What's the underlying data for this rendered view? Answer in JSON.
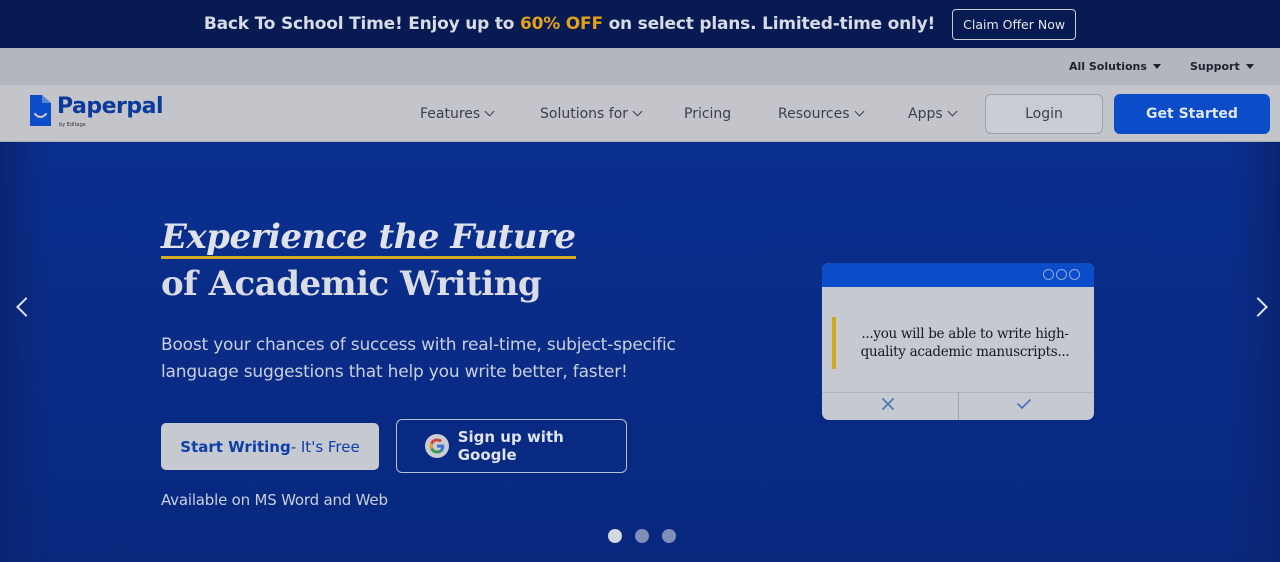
{
  "promo": {
    "text_before": "Back To School Time! Enjoy up to ",
    "highlight": "60% OFF",
    "text_after": " on select plans. Limited-time only!",
    "cta": "Claim Offer Now",
    "highlight_color": "#e3a11a"
  },
  "utility": {
    "all_solutions": "All Solutions",
    "support": "Support"
  },
  "nav": {
    "logo_text": "Paperpal",
    "logo_sub": "by Editage",
    "items": [
      "Features",
      "Solutions for",
      "Pricing",
      "Resources",
      "Apps"
    ],
    "login": "Login",
    "get_started": "Get Started"
  },
  "hero": {
    "headline_1": "Experience the Future",
    "headline_2": "of Academic Writing",
    "subtitle": "Boost your chances of success with real-time, subject-specific language suggestions that help you write better, faster!",
    "start_bold": "Start Writing",
    "start_light": " - It's Free",
    "google_label": "Sign up with Google",
    "available": "Available on MS Word and Web",
    "slide_index": 1,
    "slide_count": 3
  },
  "card": {
    "text": "...you will be able to write high-quality academic manuscripts...",
    "accent_color": "#0b4dc8"
  }
}
